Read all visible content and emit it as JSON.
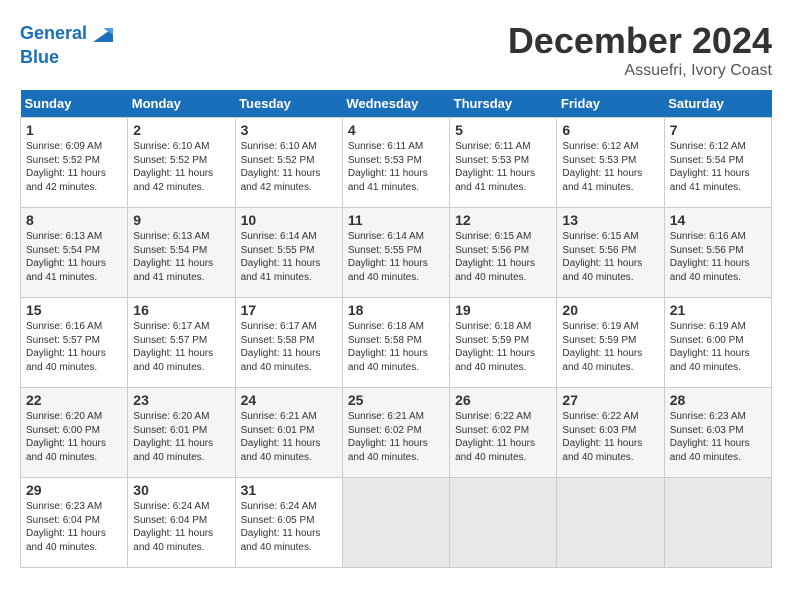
{
  "logo": {
    "line1": "General",
    "line2": "Blue"
  },
  "title": "December 2024",
  "subtitle": "Assuefri, Ivory Coast",
  "weekdays": [
    "Sunday",
    "Monday",
    "Tuesday",
    "Wednesday",
    "Thursday",
    "Friday",
    "Saturday"
  ],
  "weeks": [
    [
      {
        "day": "1",
        "info": "Sunrise: 6:09 AM\nSunset: 5:52 PM\nDaylight: 11 hours\nand 42 minutes."
      },
      {
        "day": "2",
        "info": "Sunrise: 6:10 AM\nSunset: 5:52 PM\nDaylight: 11 hours\nand 42 minutes."
      },
      {
        "day": "3",
        "info": "Sunrise: 6:10 AM\nSunset: 5:52 PM\nDaylight: 11 hours\nand 42 minutes."
      },
      {
        "day": "4",
        "info": "Sunrise: 6:11 AM\nSunset: 5:53 PM\nDaylight: 11 hours\nand 41 minutes."
      },
      {
        "day": "5",
        "info": "Sunrise: 6:11 AM\nSunset: 5:53 PM\nDaylight: 11 hours\nand 41 minutes."
      },
      {
        "day": "6",
        "info": "Sunrise: 6:12 AM\nSunset: 5:53 PM\nDaylight: 11 hours\nand 41 minutes."
      },
      {
        "day": "7",
        "info": "Sunrise: 6:12 AM\nSunset: 5:54 PM\nDaylight: 11 hours\nand 41 minutes."
      }
    ],
    [
      {
        "day": "8",
        "info": "Sunrise: 6:13 AM\nSunset: 5:54 PM\nDaylight: 11 hours\nand 41 minutes."
      },
      {
        "day": "9",
        "info": "Sunrise: 6:13 AM\nSunset: 5:54 PM\nDaylight: 11 hours\nand 41 minutes."
      },
      {
        "day": "10",
        "info": "Sunrise: 6:14 AM\nSunset: 5:55 PM\nDaylight: 11 hours\nand 41 minutes."
      },
      {
        "day": "11",
        "info": "Sunrise: 6:14 AM\nSunset: 5:55 PM\nDaylight: 11 hours\nand 40 minutes."
      },
      {
        "day": "12",
        "info": "Sunrise: 6:15 AM\nSunset: 5:56 PM\nDaylight: 11 hours\nand 40 minutes."
      },
      {
        "day": "13",
        "info": "Sunrise: 6:15 AM\nSunset: 5:56 PM\nDaylight: 11 hours\nand 40 minutes."
      },
      {
        "day": "14",
        "info": "Sunrise: 6:16 AM\nSunset: 5:56 PM\nDaylight: 11 hours\nand 40 minutes."
      }
    ],
    [
      {
        "day": "15",
        "info": "Sunrise: 6:16 AM\nSunset: 5:57 PM\nDaylight: 11 hours\nand 40 minutes."
      },
      {
        "day": "16",
        "info": "Sunrise: 6:17 AM\nSunset: 5:57 PM\nDaylight: 11 hours\nand 40 minutes."
      },
      {
        "day": "17",
        "info": "Sunrise: 6:17 AM\nSunset: 5:58 PM\nDaylight: 11 hours\nand 40 minutes."
      },
      {
        "day": "18",
        "info": "Sunrise: 6:18 AM\nSunset: 5:58 PM\nDaylight: 11 hours\nand 40 minutes."
      },
      {
        "day": "19",
        "info": "Sunrise: 6:18 AM\nSunset: 5:59 PM\nDaylight: 11 hours\nand 40 minutes."
      },
      {
        "day": "20",
        "info": "Sunrise: 6:19 AM\nSunset: 5:59 PM\nDaylight: 11 hours\nand 40 minutes."
      },
      {
        "day": "21",
        "info": "Sunrise: 6:19 AM\nSunset: 6:00 PM\nDaylight: 11 hours\nand 40 minutes."
      }
    ],
    [
      {
        "day": "22",
        "info": "Sunrise: 6:20 AM\nSunset: 6:00 PM\nDaylight: 11 hours\nand 40 minutes."
      },
      {
        "day": "23",
        "info": "Sunrise: 6:20 AM\nSunset: 6:01 PM\nDaylight: 11 hours\nand 40 minutes."
      },
      {
        "day": "24",
        "info": "Sunrise: 6:21 AM\nSunset: 6:01 PM\nDaylight: 11 hours\nand 40 minutes."
      },
      {
        "day": "25",
        "info": "Sunrise: 6:21 AM\nSunset: 6:02 PM\nDaylight: 11 hours\nand 40 minutes."
      },
      {
        "day": "26",
        "info": "Sunrise: 6:22 AM\nSunset: 6:02 PM\nDaylight: 11 hours\nand 40 minutes."
      },
      {
        "day": "27",
        "info": "Sunrise: 6:22 AM\nSunset: 6:03 PM\nDaylight: 11 hours\nand 40 minutes."
      },
      {
        "day": "28",
        "info": "Sunrise: 6:23 AM\nSunset: 6:03 PM\nDaylight: 11 hours\nand 40 minutes."
      }
    ],
    [
      {
        "day": "29",
        "info": "Sunrise: 6:23 AM\nSunset: 6:04 PM\nDaylight: 11 hours\nand 40 minutes."
      },
      {
        "day": "30",
        "info": "Sunrise: 6:24 AM\nSunset: 6:04 PM\nDaylight: 11 hours\nand 40 minutes."
      },
      {
        "day": "31",
        "info": "Sunrise: 6:24 AM\nSunset: 6:05 PM\nDaylight: 11 hours\nand 40 minutes."
      },
      {
        "day": "",
        "info": ""
      },
      {
        "day": "",
        "info": ""
      },
      {
        "day": "",
        "info": ""
      },
      {
        "day": "",
        "info": ""
      }
    ]
  ]
}
